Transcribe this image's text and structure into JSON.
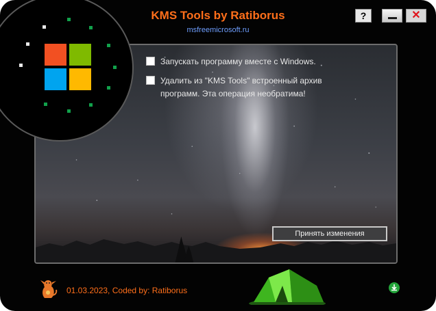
{
  "window": {
    "title": "KMS Tools by Ratiborus",
    "subtitle": "msfreemicrosoft.ru",
    "help_label": "?",
    "close_label": "✕"
  },
  "options": [
    {
      "label": "Запускать программу вместе с Windows.",
      "checked": false
    },
    {
      "label": "Удалить из \"KMS Tools\" встроенный архив программ.  Эта операция необратима!",
      "checked": false
    }
  ],
  "apply_button": {
    "label": "Принять изменения"
  },
  "footer": {
    "text": "01.03.2023, Coded by: Ratiborus"
  },
  "icons": {
    "logo": "microsoft-logo",
    "mascot": "dragon-icon",
    "tent": "tent-icon",
    "download": "download-icon"
  },
  "colors": {
    "accent": "#ff6f1a",
    "subtitle": "#6f9fff",
    "logo_red": "#f25022",
    "logo_green": "#7fba00",
    "logo_blue": "#00a4ef",
    "logo_yellow": "#ffb900"
  }
}
